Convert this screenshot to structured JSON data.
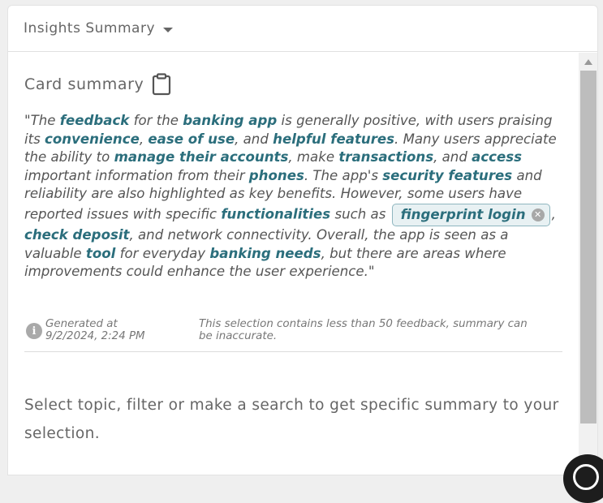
{
  "panel": {
    "title": "Insights Summary"
  },
  "card": {
    "title": "Card summary",
    "summary": {
      "t01": "\"The ",
      "k01": "feedback",
      "t02": " for the ",
      "k02": "banking app",
      "t03": " is generally positive, with users praising its ",
      "k03": "convenience",
      "t04": ", ",
      "k04": "ease of use",
      "t05": ", and ",
      "k05": "helpful features",
      "t06": ". Many users appreciate the ability to ",
      "k06": "manage their accounts",
      "t07": ", make ",
      "k07": "transactions",
      "t08": ", and ",
      "k08": "access",
      "t09": " important information from their ",
      "k09": "phones",
      "t10": ". The app's ",
      "k10": "security features",
      "t11": " and reliability are also highlighted as key benefits. However, some users have reported issues with specific ",
      "k11": "functionalities",
      "t12": " such as ",
      "chip": "fingerprint login",
      "t13": ", ",
      "k13": "check deposit",
      "t14": ", and network connectivity. Overall, the app is seen as a valuable ",
      "k14": "tool",
      "t15": " for everyday ",
      "k15": "banking needs",
      "t16": ", but there are areas where improvements could enhance the user experience.\""
    },
    "generated_label": "Generated at",
    "generated_time": "9/2/2024, 2:24 PM",
    "warning": "This selection contains less than 50 feedback, summary can be inaccurate."
  },
  "hint": "Select topic, filter or make a search to get specific summary to your selection.",
  "icons": {
    "header_caret": "caret-down-icon",
    "card_title": "clipboard-icon",
    "chip_remove": "close-circle-icon",
    "meta": "info-icon",
    "chat": "chat-icon"
  },
  "colors": {
    "keyword": "#2b6e7c",
    "chip_bg": "#e8f1f3",
    "chip_border": "#8fb6bf"
  }
}
